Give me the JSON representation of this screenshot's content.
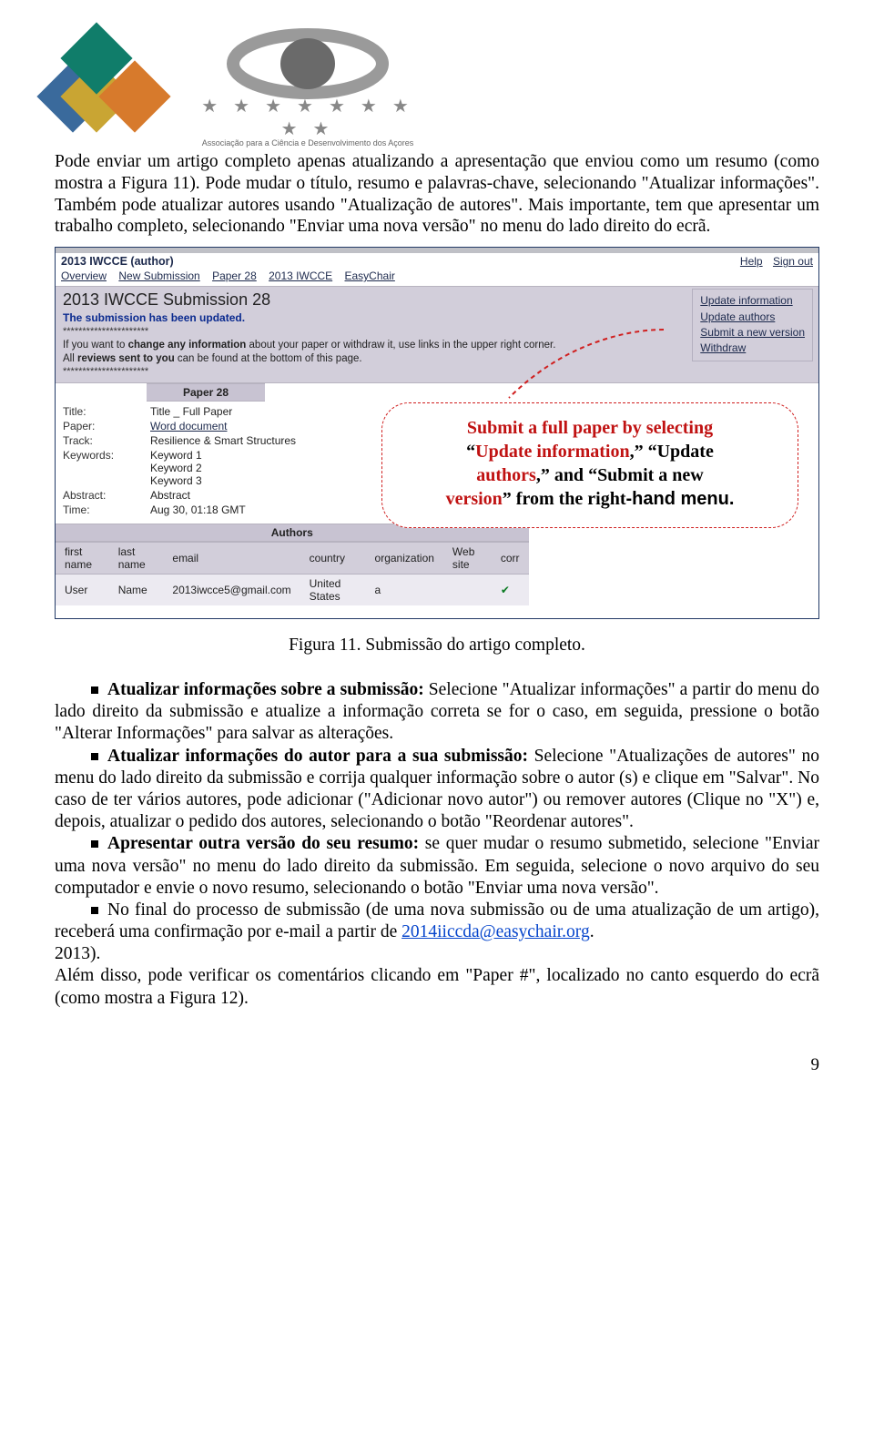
{
  "header": {
    "assoc_text": "Associação para a Ciência e Desenvolvimento dos Açores"
  },
  "intro": {
    "p1": "Pode enviar um artigo completo apenas atualizando a apresentação que enviou como um resumo (como mostra a Figura 11). Pode mudar o título, resumo e palavras-chave, selecionando \"Atualizar informações\". Também pode atualizar autores usando \"Atualização de autores\". Mais importante, tem que apresentar um trabalho completo, selecionando \"Enviar uma nova versão\" no menu do lado direito do ecrã."
  },
  "easychair": {
    "role": "2013 IWCCE (author)",
    "help": "Help",
    "signout": "Sign out",
    "menu": {
      "overview": "Overview",
      "new_submission": "New Submission",
      "paper28": "Paper 28",
      "iwcce": "2013 IWCCE",
      "easychair": "EasyChair"
    },
    "title": "2013 IWCCE Submission 28",
    "updated_msg": "The submission has been updated.",
    "stars": "**********************",
    "note_prefix": "If you want to ",
    "note_bold1": "change any information",
    "note_mid": " about your paper or withdraw it, use links in the upper right corner.",
    "note2_pre": "All ",
    "note2_bold": "reviews sent to you",
    "note2_post": " can be found at the bottom of this page.",
    "side": {
      "update_info": "Update information",
      "update_authors": "Update authors",
      "submit_new": "Submit a new version",
      "withdraw": "Withdraw"
    },
    "paper_hdr": "Paper 28",
    "props": {
      "title_l": "Title:",
      "title_v": "Title _ Full Paper",
      "paper_l": "Paper:",
      "paper_v": "Word document",
      "track_l": "Track:",
      "track_v": "Resilience & Smart Structures",
      "keywords_l": "Keywords:",
      "kw1": "Keyword 1",
      "kw2": "Keyword 2",
      "kw3": "Keyword 3",
      "abstract_l": "Abstract:",
      "abstract_v": "Abstract",
      "time_l": "Time:",
      "time_v": "Aug 30, 01:18 GMT"
    },
    "authors_hdr": "Authors",
    "auth_cols": {
      "first": "first name",
      "last": "last name",
      "email": "email",
      "country": "country",
      "org": "organization",
      "web": "Web site",
      "corr": "corr"
    },
    "auth_row": {
      "first": "User",
      "last": "Name",
      "email": "2013iwcce5@gmail.com",
      "country": "United States",
      "org": "a",
      "web": "",
      "corr": "✔"
    },
    "callout": {
      "l1a": "Submit a full paper by selecting",
      "q_upd_info_open": "“",
      "upd_info": "Update information",
      "comma": ",",
      "q_close": "”",
      "q_upd_auth": "“Update",
      "authors_word": "authors",
      "and_word": " and ",
      "q_submit": "“Submit a new",
      "version_word": "version",
      "from_right": " from the right",
      "hand_menu": "-hand menu."
    }
  },
  "fig_caption": "Figura 11. Submissão do artigo completo.",
  "bullets": {
    "b1_bold": "Atualizar informações sobre a submissão:",
    "b1_rest": " Selecione \"Atualizar informações\" a partir do menu do lado direito da submissão e atualize a informação correta se for o caso, em seguida, pressione o botão \"Alterar Informações\" para salvar as alterações.",
    "b2_bold": "Atualizar informações do autor para a sua submissão:",
    "b2_rest": " Selecione \"Atualizações de autores\" no menu do lado direito da submissão e corrija qualquer informação sobre o autor (s) e clique em \"Salvar\". No caso de ter vários autores, pode adicionar (\"Adicionar novo autor\") ou remover autores (Clique no \"X\") e, depois, atualizar o pedido dos autores, selecionando o botão \"Reordenar autores\".",
    "b3_bold": "Apresentar outra versão do seu resumo:",
    "b3_rest": " se quer mudar o resumo submetido, selecione \"Enviar uma nova versão\" no menu do lado direito da submissão. Em seguida, selecione o novo arquivo do seu computador e envie o novo resumo, selecionando o botão \"Enviar uma nova versão\".",
    "b4_pre": "No final do processo de submissão (de uma nova submissão ou de uma atualização de um artigo), receberá uma confirmação por e-mail a partir de ",
    "b4_email": "2014iiccda@easychair.org",
    "b4_post": "."
  },
  "line_2013": "2013).",
  "tail": "Além disso, pode verificar os comentários clicando em \"Paper #\", localizado no canto esquerdo do ecrã (como mostra a Figura 12).",
  "page_number": "9"
}
